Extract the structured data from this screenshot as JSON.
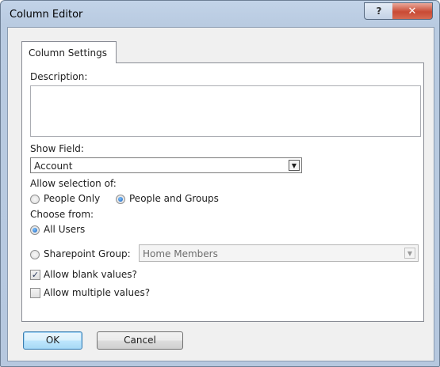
{
  "window": {
    "title": "Column Editor",
    "help_glyph": "?",
    "close_glyph": "✕"
  },
  "tabs": [
    {
      "label": "Column Settings",
      "active": true
    }
  ],
  "form": {
    "description_label": "Description:",
    "description_value": "",
    "show_field_label": "Show Field:",
    "show_field_value": "Account",
    "allow_selection_label": "Allow selection of:",
    "allow_selection_options": [
      {
        "label": "People Only",
        "selected": false
      },
      {
        "label": "People and Groups",
        "selected": true
      }
    ],
    "choose_from_label": "Choose from:",
    "choose_from_options": [
      {
        "label": "All Users",
        "selected": true
      },
      {
        "label": "Sharepoint Group:",
        "selected": false
      }
    ],
    "sharepoint_group_value": "Home Members",
    "allow_blank_label": "Allow blank values?",
    "allow_blank_checked": true,
    "allow_multiple_label": "Allow multiple values?",
    "allow_multiple_checked": false
  },
  "buttons": {
    "ok": "OK",
    "cancel": "Cancel"
  },
  "icons": {
    "dropdown": "▼",
    "check": "✓"
  }
}
